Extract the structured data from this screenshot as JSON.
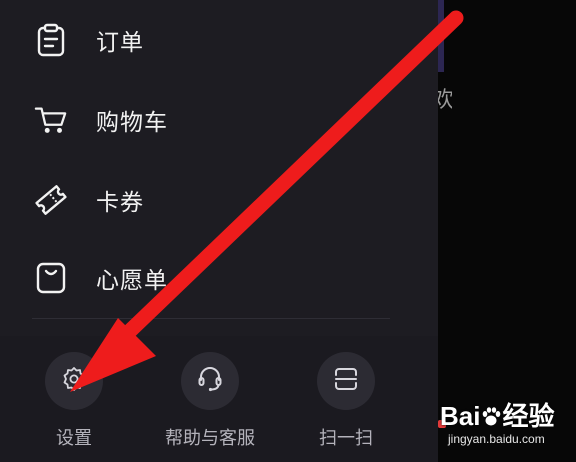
{
  "menu": {
    "items": [
      {
        "label": "订单",
        "icon": "clipboard-icon"
      },
      {
        "label": "购物车",
        "icon": "cart-icon"
      },
      {
        "label": "卡券",
        "icon": "ticket-icon"
      },
      {
        "label": "心愿单",
        "icon": "wishlist-bag-icon"
      }
    ]
  },
  "bottom_bar": {
    "settings_label": "设置",
    "help_label": "帮助与客服",
    "scan_label": "扫一扫"
  },
  "background": {
    "partial_text": "欢"
  },
  "watermark": {
    "brand": "Bai",
    "brand_suffix": "经验",
    "url": "jingyan.baidu.com"
  },
  "colors": {
    "drawer_bg": "#1d1c22",
    "annotation_arrow": "#ee1c1c",
    "text_primary": "#f2f2f2",
    "text_secondary": "#b4b3bb"
  }
}
